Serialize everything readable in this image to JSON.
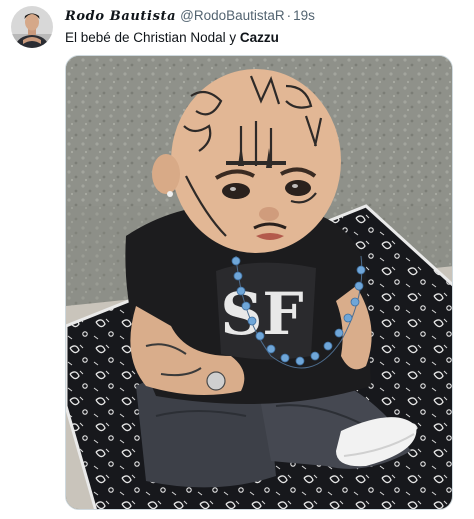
{
  "tweet": {
    "display_name": "Rodo Bautista",
    "handle": "@RodoBautistaR",
    "separator": "·",
    "time": "19s",
    "text_prefix": "El bebé de Christian Nodal y ",
    "text_bold": "Cazzu"
  },
  "avatar": {
    "icon": "profile-photo"
  },
  "media": {
    "icon": "tattooed-baby-doll-photo",
    "shirt_print": "SF",
    "colors": {
      "wall": "#8f918a",
      "bandana": "#17181c",
      "skin": "#e2b795",
      "shirt": "#1c1c1e",
      "jeans": "#3d4048",
      "beads": "#6fa6d8"
    }
  }
}
